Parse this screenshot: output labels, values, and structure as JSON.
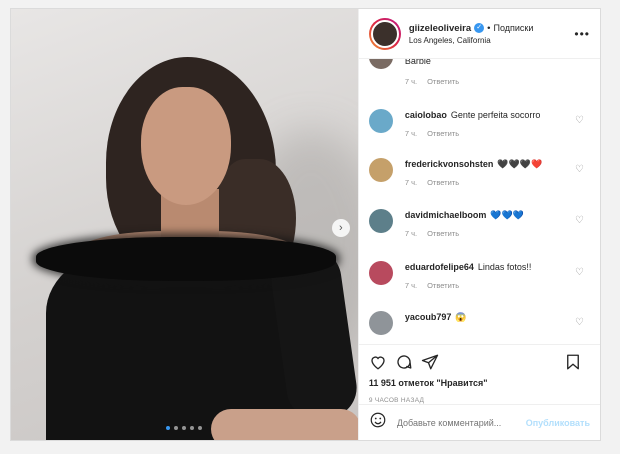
{
  "header": {
    "username": "giizeleoliveira",
    "separator": "•",
    "follow_label": "Подписки",
    "location": "Los Angeles, California",
    "more_label": "•••"
  },
  "photo": {
    "next_label": "›",
    "dots": 5,
    "active_dot": 0
  },
  "comments": [
    {
      "user": "",
      "text": "Barbie",
      "time": "7 ч.",
      "reply": "Ответить",
      "avatar_color": "#7a6b63"
    },
    {
      "user": "caiolobao",
      "text": "Gente perfeita socorro",
      "time": "7 ч.",
      "reply": "Ответить",
      "avatar_color": "#6aa9c9"
    },
    {
      "user": "frederickvonsohsten",
      "text": "🖤🖤🖤❤️",
      "time": "7 ч.",
      "reply": "Ответить",
      "avatar_color": "#c5a06a"
    },
    {
      "user": "davidmichaelboom",
      "text": "💙💙💙",
      "time": "7 ч.",
      "reply": "Ответить",
      "avatar_color": "#5d7f8a"
    },
    {
      "user": "eduardofelipe64",
      "text": "Lindas fotos!!",
      "time": "7 ч.",
      "reply": "Ответить",
      "avatar_color": "#b84a5e"
    },
    {
      "user": "yacoub797",
      "text": "😱",
      "time": "",
      "reply": "",
      "avatar_color": "#8f9499"
    }
  ],
  "likes": "11 951 отметок \"Нравится\"",
  "timestamp": "9 ЧАСОВ НАЗАД",
  "add_comment": {
    "placeholder": "Добавьте комментарий...",
    "publish": "Опубликовать"
  }
}
